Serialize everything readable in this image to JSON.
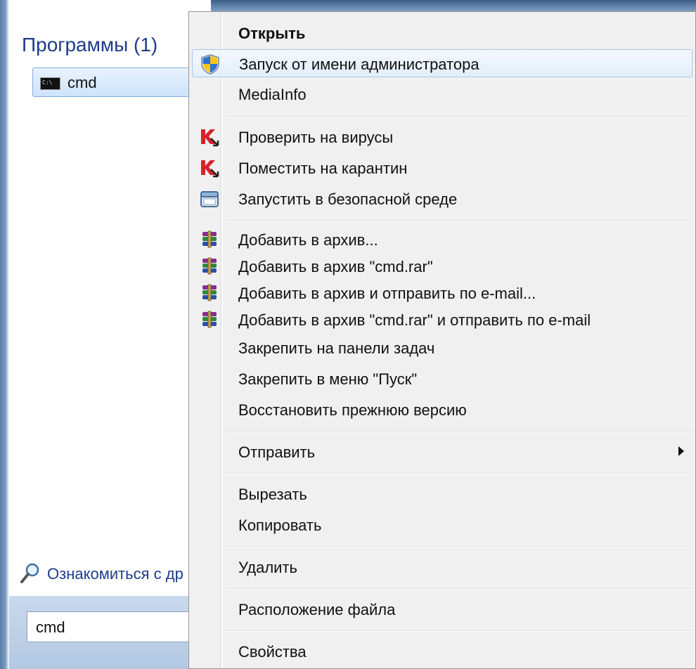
{
  "start_menu": {
    "programs_header": "Программы (1)",
    "program_item": {
      "label": "cmd",
      "icon": "console-icon",
      "icon_text": "C:\\"
    },
    "see_more_label": "Ознакомиться с др",
    "search_value": "cmd"
  },
  "context_menu": {
    "open": "Открыть",
    "run_as_admin": "Запуск от имени администратора",
    "mediainfo": "MediaInfo",
    "scan_virus": "Проверить на вирусы",
    "quarantine": "Поместить на карантин",
    "run_safe": "Запустить в безопасной среде",
    "add_archive": "Добавить в архив...",
    "add_archive_rar": "Добавить в архив \"cmd.rar\"",
    "add_archive_email": "Добавить в архив и отправить по e-mail...",
    "add_archive_rar_email": "Добавить в архив \"cmd.rar\" и отправить по e-mail",
    "pin_taskbar": "Закрепить на панели задач",
    "pin_start": "Закрепить в меню \"Пуск\"",
    "restore_previous": "Восстановить прежнюю версию",
    "send_to": "Отправить",
    "cut": "Вырезать",
    "copy": "Копировать",
    "delete": "Удалить",
    "file_location": "Расположение файла",
    "properties": "Свойства"
  },
  "colors": {
    "header_blue": "#1e3c8c",
    "highlight_border": "#a8c8ee",
    "menu_background": "#f0f0f0"
  }
}
